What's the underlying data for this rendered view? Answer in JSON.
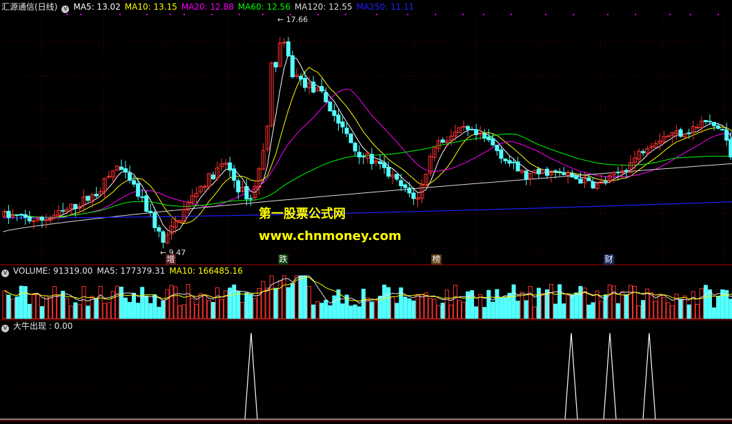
{
  "header": {
    "title": "汇源通信(日线)",
    "ma": [
      {
        "label": "MA5: 13.02",
        "color": "#ffffff"
      },
      {
        "label": "MA10: 13.15",
        "color": "#ffff00"
      },
      {
        "label": "MA20: 12.88",
        "color": "#ff00ff"
      },
      {
        "label": "MA60: 12.56",
        "color": "#00ff00"
      },
      {
        "label": "MA120: 12.55",
        "color": "#dcdcdc"
      },
      {
        "label": "MA250: 11.11",
        "color": "#2020ff"
      }
    ]
  },
  "volume_header": {
    "label": "VOLUME: 91319.00",
    "ma5": "MA5: 177379.31",
    "ma10": "MA10: 166485.16"
  },
  "indicator_header": {
    "label": "大牛出现 : 0.00"
  },
  "annotations": {
    "high": "17.66",
    "low": "9.47"
  },
  "watermark": {
    "line1": "第一股票公式网",
    "line2": "www.chnmoney.com"
  },
  "event_tags": [
    {
      "text": "增",
      "bg": "#5a1e1e",
      "color": "#ffffff"
    },
    {
      "text": "跌",
      "bg": "#0c3a0c",
      "color": "#ffffff"
    },
    {
      "text": "榜",
      "bg": "#5a3a10",
      "color": "#ffffff"
    },
    {
      "text": "财",
      "bg": "#1a2a5a",
      "color": "#ffffff"
    }
  ],
  "colors": {
    "up": "#ff3232",
    "down": "#54ffff",
    "grid": "#800000",
    "divider": "#b00000"
  },
  "chart_data": [
    {
      "type": "candlestick",
      "title": "汇源通信(日线)",
      "series": [
        {
          "name": "MA5",
          "last": 13.02
        },
        {
          "name": "MA10",
          "last": 13.15
        },
        {
          "name": "MA20",
          "last": 12.88
        },
        {
          "name": "MA60",
          "last": 12.56
        },
        {
          "name": "MA120",
          "last": 12.55
        },
        {
          "name": "MA250",
          "last": 11.11
        }
      ],
      "annotations": [
        {
          "text": "17.66",
          "kind": "max"
        },
        {
          "text": "9.47",
          "kind": "min"
        }
      ]
    },
    {
      "type": "bar",
      "title": "VOLUME",
      "series": [
        {
          "name": "VOLUME",
          "last": 91319.0
        },
        {
          "name": "MA5",
          "last": 177379.31
        },
        {
          "name": "MA10",
          "last": 166485.16
        }
      ]
    },
    {
      "type": "line",
      "title": "大牛出现",
      "series": [
        {
          "name": "大牛出现",
          "last": 0.0,
          "signals": 4
        }
      ]
    }
  ]
}
